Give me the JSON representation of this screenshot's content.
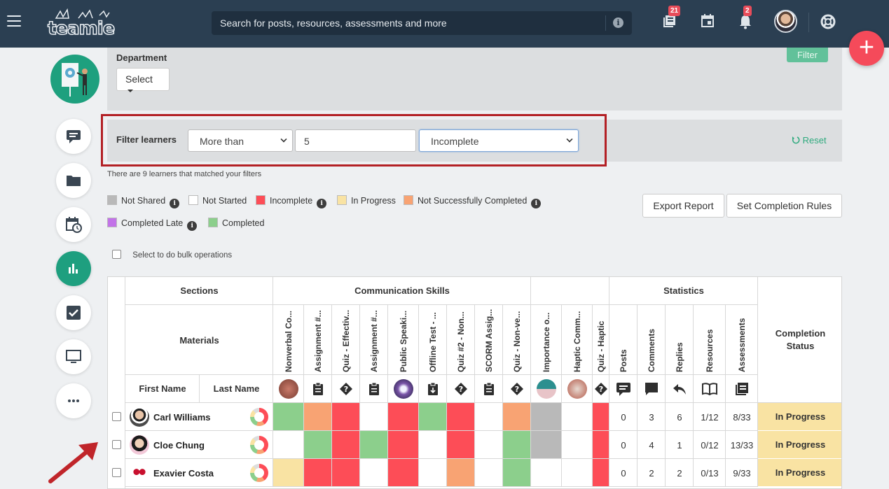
{
  "topbar": {
    "logo": "teamie",
    "search_placeholder": "Search for posts, resources, assessments and more",
    "badges": {
      "newsfeed": "21",
      "notifications": "2"
    }
  },
  "department": {
    "label": "Department",
    "select_label": "Select",
    "filter_button": "Filter"
  },
  "filter": {
    "label": "Filter learners",
    "comparator": "More than",
    "value": "5",
    "status": "Incomplete",
    "reset": "Reset",
    "match_text": "There are 9 learners that matched your filters"
  },
  "legend": [
    {
      "label": "Not Shared",
      "color": "#b9b9b9",
      "info": true
    },
    {
      "label": "Not Started",
      "color": "#ffffff",
      "info": false
    },
    {
      "label": "Incomplete",
      "color": "#fd4d57",
      "info": true
    },
    {
      "label": "In Progress",
      "color": "#f9e3a3",
      "info": false
    },
    {
      "label": "Not Successfully Completed",
      "color": "#f8a373",
      "info": true
    },
    {
      "label": "Completed Late",
      "color": "#c273e8",
      "info": true
    },
    {
      "label": "Completed",
      "color": "#8ccf8c",
      "info": false
    }
  ],
  "buttons": {
    "export": "Export Report",
    "rules": "Set Completion Rules"
  },
  "bulk_label": "Select to do bulk operations",
  "table": {
    "sections_label": "Sections",
    "materials_label": "Materials",
    "first_name": "First Name",
    "last_name": "Last Name",
    "comm_section": "Communication Skills",
    "stats_section": "Statistics",
    "completion_status": "Completion Status",
    "materials": [
      "Nonverbal Co...",
      "Assignment #...",
      "Quiz - Effectiv...",
      "Assignment #...",
      "Public Speaki...",
      "Offline Test - ...",
      "Quiz #2 - Non...",
      "SCORM Assig...",
      "Quiz - Non-ve...",
      "Importance o...",
      "Haptic Comm...",
      "Quiz - Haptic"
    ],
    "stats": [
      "Posts",
      "Comments",
      "Replies",
      "Resources",
      "Assessments"
    ],
    "rows": [
      {
        "first": "Carl Williams",
        "stats": [
          "0",
          "3",
          "6",
          "1/12",
          "8/33"
        ],
        "status": "In Progress"
      },
      {
        "first": "Cloe Chung",
        "stats": [
          "0",
          "4",
          "1",
          "0/12",
          "13/33"
        ],
        "status": "In Progress"
      },
      {
        "first": "Exavier Costa",
        "stats": [
          "0",
          "2",
          "2",
          "0/13",
          "9/33"
        ],
        "status": "In Progress"
      }
    ]
  }
}
